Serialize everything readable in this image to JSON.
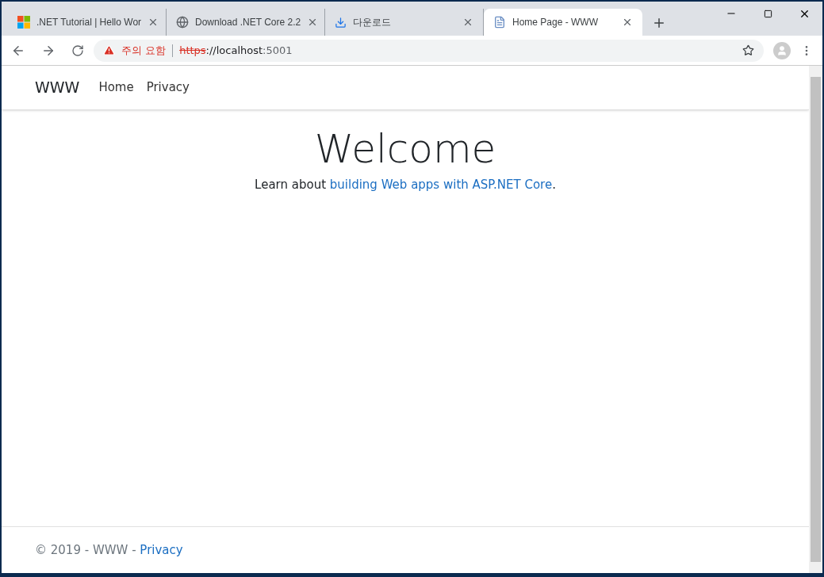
{
  "tabs": [
    {
      "kind": "windows",
      "title": ".NET Tutorial | Hello Wor",
      "selected": false
    },
    {
      "kind": "globe",
      "title": "Download .NET Core 2.2",
      "selected": false
    },
    {
      "kind": "download",
      "title": "다운로드",
      "selected": false
    },
    {
      "kind": "page",
      "title": "Home Page - WWW",
      "selected": true
    }
  ],
  "address_bar": {
    "warning": "주의 요함",
    "scheme": "https",
    "host": "://localhost",
    "port": ":5001"
  },
  "navbar": {
    "brand": "WWW",
    "links": [
      "Home",
      "Privacy"
    ]
  },
  "main": {
    "heading": "Welcome",
    "lead": "Learn about ",
    "link": "building Web apps with ASP.NET Core",
    "tail": "."
  },
  "footer": {
    "text": "© 2019 - WWW - ",
    "link": "Privacy"
  }
}
